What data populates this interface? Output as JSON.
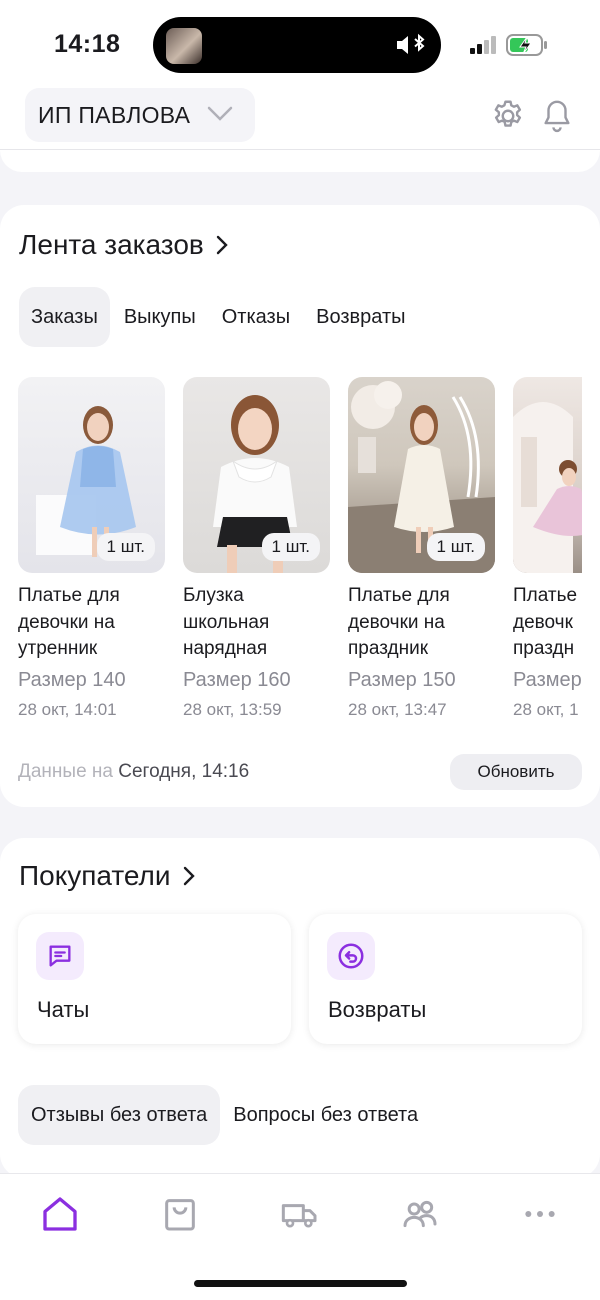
{
  "status_bar": {
    "time": "14:18"
  },
  "header": {
    "org_name": "ИП ПАВЛОВА"
  },
  "orders": {
    "title": "Лента заказов",
    "tabs": [
      {
        "label": "Заказы",
        "active": true
      },
      {
        "label": "Выкупы",
        "active": false
      },
      {
        "label": "Отказы",
        "active": false
      },
      {
        "label": "Возвраты",
        "active": false
      }
    ],
    "items": [
      {
        "name_lines": [
          "Платье для",
          "девочки на",
          "утренник"
        ],
        "qty": "1 шт.",
        "size": "Размер 140",
        "date": "28 окт, 14:01"
      },
      {
        "name_lines": [
          "Блузка",
          "школьная",
          "нарядная"
        ],
        "qty": "1 шт.",
        "size": "Размер 160",
        "date": "28 окт, 13:59"
      },
      {
        "name_lines": [
          "Платье для",
          "девочки на",
          "праздник"
        ],
        "qty": "1 шт.",
        "size": "Размер 150",
        "date": "28 окт, 13:47"
      },
      {
        "name_lines": [
          "Платье",
          "девочк",
          "праздн"
        ],
        "qty": "",
        "size": "Размер",
        "date": "28 окт, 1"
      }
    ],
    "updated_prefix": "Данные на",
    "updated_value": "Сегодня, 14:16",
    "refresh_label": "Обновить"
  },
  "buyers": {
    "title": "Покупатели",
    "tiles": [
      {
        "label": "Чаты",
        "icon": "chat-icon"
      },
      {
        "label": "Возвраты",
        "icon": "return-icon"
      }
    ],
    "chips": [
      {
        "label": "Отзывы без ответа",
        "active": true
      },
      {
        "label": "Вопросы без ответа",
        "active": false
      }
    ]
  },
  "nav": {
    "items": [
      {
        "icon": "home-icon",
        "active": true
      },
      {
        "icon": "bag-icon",
        "active": false
      },
      {
        "icon": "truck-icon",
        "active": false
      },
      {
        "icon": "users-icon",
        "active": false
      },
      {
        "icon": "more-icon",
        "active": false
      }
    ]
  },
  "colors": {
    "accent": "#8b2fe0",
    "muted": "#8a8a93",
    "icon_gray": "#a8a8b0"
  }
}
